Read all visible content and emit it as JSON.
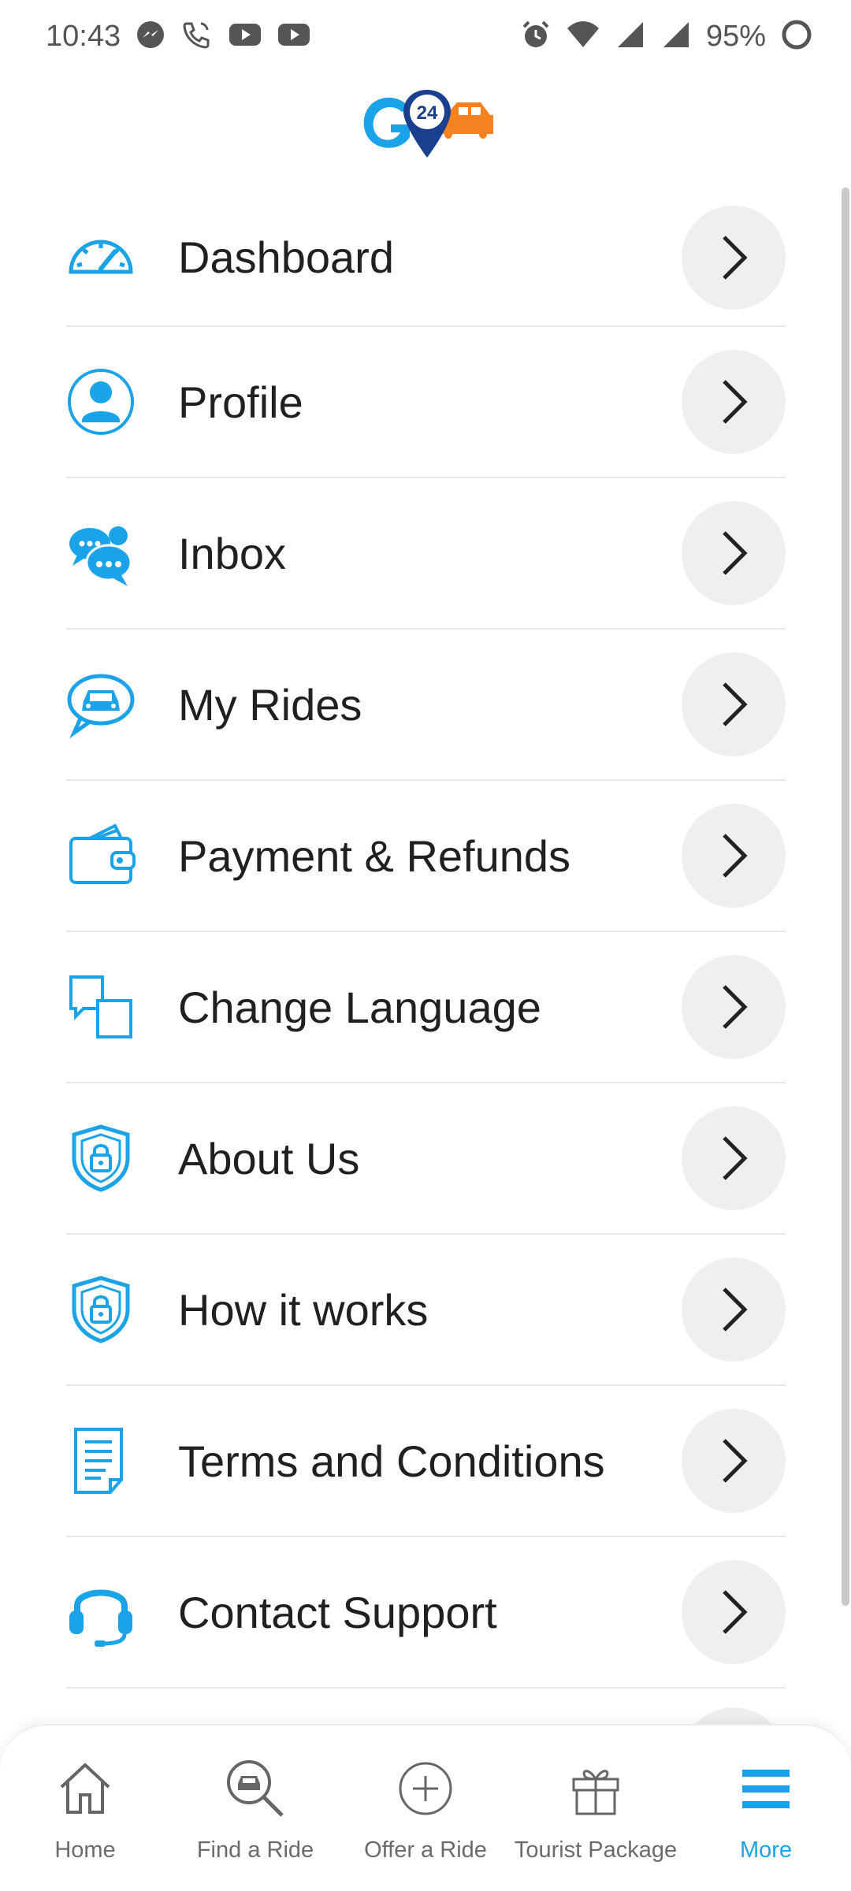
{
  "status_bar": {
    "time": "10:43",
    "battery_percent": "95%",
    "notification_icons": [
      "messenger-icon",
      "wifi-call-icon",
      "youtube-icon",
      "youtube-icon"
    ],
    "system_icons": [
      "alarm-icon",
      "wifi-icon",
      "signal-icon",
      "signal-icon",
      "battery-icon"
    ]
  },
  "app": {
    "logo_text": "24",
    "brand_blue": "#1aa3e8",
    "brand_orange": "#f58220"
  },
  "menu": {
    "items": [
      {
        "label": "Dashboard",
        "icon": "speedometer-icon"
      },
      {
        "label": "Profile",
        "icon": "user-icon"
      },
      {
        "label": "Inbox",
        "icon": "chat-icon"
      },
      {
        "label": "My Rides",
        "icon": "car-bubble-icon"
      },
      {
        "label": "Payment & Refunds",
        "icon": "wallet-icon"
      },
      {
        "label": "Change Language",
        "icon": "language-icon"
      },
      {
        "label": "About Us",
        "icon": "shield-lock-icon"
      },
      {
        "label": "How it works",
        "icon": "shield-lock-icon"
      },
      {
        "label": "Terms and Conditions",
        "icon": "document-icon"
      },
      {
        "label": "Contact Support",
        "icon": "headset-icon"
      }
    ]
  },
  "bottom_nav": {
    "items": [
      {
        "label": "Home",
        "icon": "home-icon"
      },
      {
        "label": "Find a Ride",
        "icon": "search-car-icon"
      },
      {
        "label": "Offer a Ride",
        "icon": "plus-circle-icon"
      },
      {
        "label": "Tourist Package",
        "icon": "gift-icon"
      },
      {
        "label": "More",
        "icon": "menu-icon",
        "active": true
      }
    ]
  }
}
